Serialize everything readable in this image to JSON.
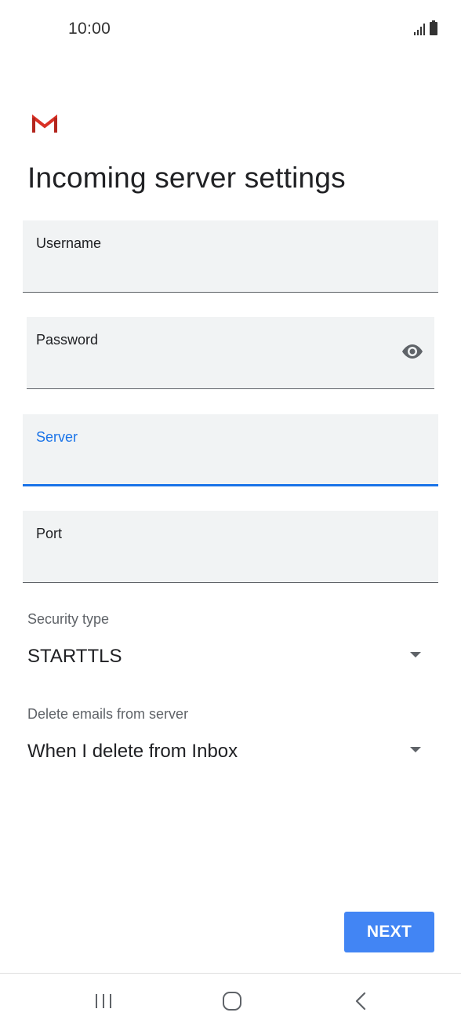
{
  "status_bar": {
    "time": "10:00",
    "icons": [
      "signal-icon",
      "battery-icon"
    ]
  },
  "app": {
    "logo": "gmail-logo",
    "title": "Incoming server settings"
  },
  "fields": {
    "username": {
      "label": "Username",
      "value": ""
    },
    "password": {
      "label": "Password",
      "value": "",
      "icon": "eye-icon"
    },
    "server": {
      "label": "Server",
      "value": "",
      "focused": true
    },
    "port": {
      "label": "Port",
      "value": ""
    }
  },
  "security_type": {
    "label": "Security type",
    "value": "STARTTLS"
  },
  "delete_emails": {
    "label": "Delete emails from server",
    "value": "When I delete from Inbox"
  },
  "actions": {
    "next_label": "NEXT"
  },
  "nav": {
    "icons": [
      "recent-apps-icon",
      "home-icon",
      "back-icon"
    ]
  },
  "colors": {
    "accent": "#1a73e8",
    "button": "#4285f4",
    "field_bg": "#f1f3f4",
    "gmail_red": "#d93025"
  }
}
